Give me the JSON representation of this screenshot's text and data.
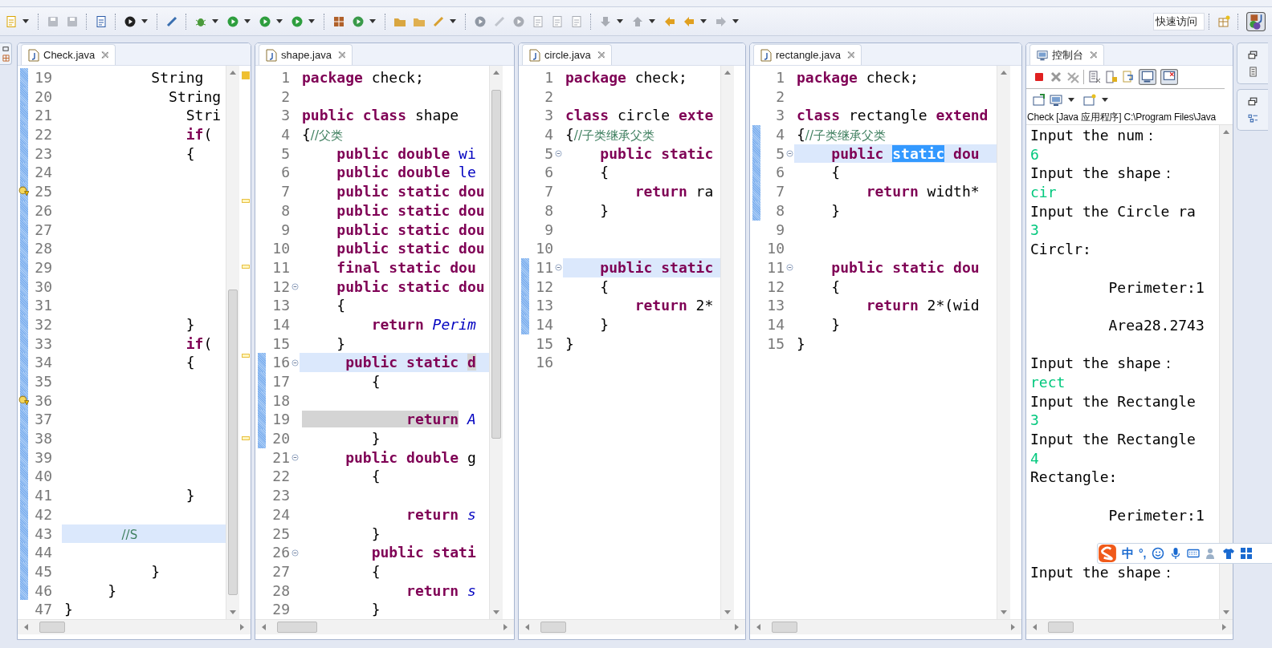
{
  "quick_access": {
    "placeholder": "快速访问"
  },
  "editors": [
    {
      "tab": "Check.java",
      "lines": [
        {
          "num": "19",
          "changed": true,
          "current": false,
          "fold": false,
          "warning": false,
          "tokens": [
            {
              "kind": "pl",
              "text": "          String"
            }
          ]
        },
        {
          "num": "20",
          "changed": true,
          "current": false,
          "fold": false,
          "warning": false,
          "tokens": [
            {
              "kind": "pl",
              "text": "            String"
            }
          ]
        },
        {
          "num": "21",
          "changed": true,
          "current": false,
          "fold": false,
          "warning": false,
          "tokens": [
            {
              "kind": "pl",
              "text": "              Stri"
            }
          ]
        },
        {
          "num": "22",
          "changed": true,
          "current": false,
          "fold": false,
          "warning": false,
          "tokens": [
            {
              "kind": "kw",
              "text": "              if"
            },
            {
              "kind": "pl",
              "text": "("
            }
          ]
        },
        {
          "num": "23",
          "changed": true,
          "current": false,
          "fold": false,
          "warning": false,
          "tokens": [
            {
              "kind": "pl",
              "text": "              {"
            }
          ]
        },
        {
          "num": "24",
          "changed": true,
          "current": false,
          "fold": false,
          "warning": false
        },
        {
          "num": "25",
          "changed": true,
          "current": false,
          "fold": false,
          "warning": true
        },
        {
          "num": "26",
          "changed": true,
          "current": false,
          "fold": false,
          "warning": false
        },
        {
          "num": "27",
          "changed": true,
          "current": false,
          "fold": false,
          "warning": false
        },
        {
          "num": "28",
          "changed": true,
          "current": false,
          "fold": false,
          "warning": false
        },
        {
          "num": "29",
          "changed": true,
          "current": false,
          "fold": false,
          "warning": false
        },
        {
          "num": "30",
          "changed": true,
          "current": false,
          "fold": false,
          "warning": false
        },
        {
          "num": "31",
          "changed": true,
          "current": false,
          "fold": false,
          "warning": false
        },
        {
          "num": "32",
          "changed": true,
          "current": false,
          "fold": false,
          "warning": false,
          "tokens": [
            {
              "kind": "pl",
              "text": "              }"
            }
          ]
        },
        {
          "num": "33",
          "changed": true,
          "current": false,
          "fold": false,
          "warning": false,
          "tokens": [
            {
              "kind": "kw",
              "text": "              if"
            },
            {
              "kind": "pl",
              "text": "("
            }
          ]
        },
        {
          "num": "34",
          "changed": true,
          "current": false,
          "fold": false,
          "warning": false,
          "tokens": [
            {
              "kind": "pl",
              "text": "              {"
            }
          ]
        },
        {
          "num": "35",
          "changed": true,
          "current": false,
          "fold": false,
          "warning": false
        },
        {
          "num": "36",
          "changed": true,
          "current": false,
          "fold": false,
          "warning": true
        },
        {
          "num": "37",
          "changed": true,
          "current": false,
          "fold": false,
          "warning": false
        },
        {
          "num": "38",
          "changed": true,
          "current": false,
          "fold": false,
          "warning": false
        },
        {
          "num": "39",
          "changed": true,
          "current": false,
          "fold": false,
          "warning": false
        },
        {
          "num": "40",
          "changed": true,
          "current": false,
          "fold": false,
          "warning": false
        },
        {
          "num": "41",
          "changed": true,
          "current": false,
          "fold": false,
          "warning": false,
          "tokens": [
            {
              "kind": "pl",
              "text": "              }"
            }
          ]
        },
        {
          "num": "42",
          "changed": true,
          "current": false,
          "fold": false,
          "warning": false
        },
        {
          "num": "43",
          "changed": true,
          "current": true,
          "fold": false,
          "warning": false,
          "tokens": [
            {
              "kind": "cm",
              "text": "               //S"
            }
          ]
        },
        {
          "num": "44",
          "changed": true,
          "current": false,
          "fold": false,
          "warning": false
        },
        {
          "num": "45",
          "changed": true,
          "current": false,
          "fold": false,
          "warning": false,
          "tokens": [
            {
              "kind": "pl",
              "text": "          }"
            }
          ]
        },
        {
          "num": "46",
          "changed": true,
          "current": false,
          "fold": false,
          "warning": false,
          "tokens": [
            {
              "kind": "pl",
              "text": "     }"
            }
          ]
        },
        {
          "num": "47",
          "changed": false,
          "current": false,
          "fold": false,
          "warning": false,
          "tokens": [
            {
              "kind": "pl",
              "text": "}"
            }
          ]
        }
      ]
    },
    {
      "tab": "shape.java",
      "lines": [
        {
          "num": "1",
          "changed": false,
          "current": false,
          "fold": false,
          "warning": false,
          "tokens": [
            {
              "kind": "kw",
              "text": "package"
            },
            {
              "kind": "pl",
              "text": " check;"
            }
          ]
        },
        {
          "num": "2",
          "changed": false,
          "current": false,
          "fold": false,
          "warning": false
        },
        {
          "num": "3",
          "changed": false,
          "current": false,
          "fold": false,
          "warning": false,
          "tokens": [
            {
              "kind": "kw",
              "text": "public class"
            },
            {
              "kind": "pl",
              "text": " shape"
            }
          ]
        },
        {
          "num": "4",
          "changed": false,
          "current": false,
          "fold": false,
          "warning": false,
          "tokens": [
            {
              "kind": "pl",
              "text": "{"
            },
            {
              "kind": "cm",
              "text": "//父类"
            }
          ]
        },
        {
          "num": "5",
          "changed": false,
          "current": false,
          "fold": false,
          "warning": false,
          "tokens": [
            {
              "kind": "kw",
              "text": "    public double"
            },
            {
              "kind": "fld",
              "text": " wi"
            }
          ]
        },
        {
          "num": "6",
          "changed": false,
          "current": false,
          "fold": false,
          "warning": false,
          "tokens": [
            {
              "kind": "kw",
              "text": "    public double"
            },
            {
              "kind": "fld",
              "text": " le"
            }
          ]
        },
        {
          "num": "7",
          "changed": false,
          "current": false,
          "fold": false,
          "warning": false,
          "tokens": [
            {
              "kind": "kw",
              "text": "    public static dou"
            }
          ]
        },
        {
          "num": "8",
          "changed": false,
          "current": false,
          "fold": false,
          "warning": false,
          "tokens": [
            {
              "kind": "kw",
              "text": "    public static dou"
            }
          ]
        },
        {
          "num": "9",
          "changed": false,
          "current": false,
          "fold": false,
          "warning": false,
          "tokens": [
            {
              "kind": "kw",
              "text": "    public static dou"
            }
          ]
        },
        {
          "num": "10",
          "changed": false,
          "current": false,
          "fold": false,
          "warning": false,
          "tokens": [
            {
              "kind": "kw",
              "text": "    public static dou"
            }
          ]
        },
        {
          "num": "11",
          "changed": false,
          "current": false,
          "fold": false,
          "warning": false,
          "tokens": [
            {
              "kind": "kw",
              "text": "    final static dou"
            }
          ]
        },
        {
          "num": "12",
          "changed": false,
          "current": false,
          "fold": true,
          "warning": false,
          "tokens": [
            {
              "kind": "kw",
              "text": "    public static dou"
            }
          ]
        },
        {
          "num": "13",
          "changed": false,
          "current": false,
          "fold": false,
          "warning": false,
          "tokens": [
            {
              "kind": "pl",
              "text": "    {"
            }
          ]
        },
        {
          "num": "14",
          "changed": false,
          "current": false,
          "fold": false,
          "warning": false,
          "tokens": [
            {
              "kind": "kw",
              "text": "        return"
            },
            {
              "kind": "fldi",
              "text": " Perim"
            }
          ]
        },
        {
          "num": "15",
          "changed": false,
          "current": false,
          "fold": false,
          "warning": false,
          "tokens": [
            {
              "kind": "pl",
              "text": "    }"
            }
          ]
        },
        {
          "num": "16",
          "changed": true,
          "current": true,
          "fold": true,
          "warning": false,
          "tokens": [
            {
              "kind": "kw",
              "text": "     public static "
            },
            {
              "kind": "occ",
              "text": "d"
            }
          ]
        },
        {
          "num": "17",
          "changed": true,
          "current": false,
          "fold": false,
          "warning": false,
          "tokens": [
            {
              "kind": "pl",
              "text": "        {"
            }
          ]
        },
        {
          "num": "18",
          "changed": true,
          "current": false,
          "fold": false,
          "warning": false
        },
        {
          "num": "19",
          "changed": true,
          "current": false,
          "fold": false,
          "warning": false,
          "tokens": [
            {
              "kind": "occ",
              "text": "            return"
            },
            {
              "kind": "fldi",
              "text": " A"
            }
          ]
        },
        {
          "num": "20",
          "changed": true,
          "current": false,
          "fold": false,
          "warning": false,
          "tokens": [
            {
              "kind": "pl",
              "text": "        }"
            }
          ]
        },
        {
          "num": "21",
          "changed": false,
          "current": false,
          "fold": true,
          "warning": false,
          "tokens": [
            {
              "kind": "kw",
              "text": "     public double"
            },
            {
              "kind": "pl",
              "text": " g"
            }
          ]
        },
        {
          "num": "22",
          "changed": false,
          "current": false,
          "fold": false,
          "warning": false,
          "tokens": [
            {
              "kind": "pl",
              "text": "        {"
            }
          ]
        },
        {
          "num": "23",
          "changed": false,
          "current": false,
          "fold": false,
          "warning": false
        },
        {
          "num": "24",
          "changed": false,
          "current": false,
          "fold": false,
          "warning": false,
          "tokens": [
            {
              "kind": "kw",
              "text": "            return"
            },
            {
              "kind": "fldi",
              "text": " s"
            }
          ]
        },
        {
          "num": "25",
          "changed": false,
          "current": false,
          "fold": false,
          "warning": false,
          "tokens": [
            {
              "kind": "pl",
              "text": "        }"
            }
          ]
        },
        {
          "num": "26",
          "changed": false,
          "current": false,
          "fold": true,
          "warning": false,
          "tokens": [
            {
              "kind": "kw",
              "text": "        public stati"
            }
          ]
        },
        {
          "num": "27",
          "changed": false,
          "current": false,
          "fold": false,
          "warning": false,
          "tokens": [
            {
              "kind": "pl",
              "text": "        {"
            }
          ]
        },
        {
          "num": "28",
          "changed": false,
          "current": false,
          "fold": false,
          "warning": false,
          "tokens": [
            {
              "kind": "kw",
              "text": "            return"
            },
            {
              "kind": "fldi",
              "text": " s"
            }
          ]
        },
        {
          "num": "29",
          "changed": false,
          "current": false,
          "fold": false,
          "warning": false,
          "tokens": [
            {
              "kind": "pl",
              "text": "        }"
            }
          ]
        }
      ]
    },
    {
      "tab": "circle.java",
      "lines": [
        {
          "num": "1",
          "changed": false,
          "current": false,
          "fold": false,
          "warning": false,
          "tokens": [
            {
              "kind": "kw",
              "text": "package"
            },
            {
              "kind": "pl",
              "text": " check;"
            }
          ]
        },
        {
          "num": "2",
          "changed": false,
          "current": false,
          "fold": false,
          "warning": false
        },
        {
          "num": "3",
          "changed": false,
          "current": false,
          "fold": false,
          "warning": false,
          "tokens": [
            {
              "kind": "kw",
              "text": "class"
            },
            {
              "kind": "pl",
              "text": " circle"
            },
            {
              "kind": "kw",
              "text": " exte"
            }
          ]
        },
        {
          "num": "4",
          "changed": false,
          "current": false,
          "fold": false,
          "warning": false,
          "tokens": [
            {
              "kind": "pl",
              "text": "{"
            },
            {
              "kind": "cm",
              "text": "//子类继承父类"
            }
          ]
        },
        {
          "num": "5",
          "changed": false,
          "current": false,
          "fold": true,
          "warning": false,
          "tokens": [
            {
              "kind": "kw",
              "text": "    public static"
            }
          ]
        },
        {
          "num": "6",
          "changed": false,
          "current": false,
          "fold": false,
          "warning": false,
          "tokens": [
            {
              "kind": "pl",
              "text": "    {"
            }
          ]
        },
        {
          "num": "7",
          "changed": false,
          "current": false,
          "fold": false,
          "warning": false,
          "tokens": [
            {
              "kind": "kw",
              "text": "        return"
            },
            {
              "kind": "pl",
              "text": " ra"
            }
          ]
        },
        {
          "num": "8",
          "changed": false,
          "current": false,
          "fold": false,
          "warning": false,
          "tokens": [
            {
              "kind": "pl",
              "text": "    }"
            }
          ]
        },
        {
          "num": "9",
          "changed": false,
          "current": false,
          "fold": false,
          "warning": false
        },
        {
          "num": "10",
          "changed": false,
          "current": false,
          "fold": false,
          "warning": false
        },
        {
          "num": "11",
          "changed": true,
          "current": true,
          "fold": true,
          "warning": false,
          "tokens": [
            {
              "kind": "kw",
              "text": "    public static"
            }
          ]
        },
        {
          "num": "12",
          "changed": true,
          "current": false,
          "fold": false,
          "warning": false,
          "tokens": [
            {
              "kind": "pl",
              "text": "    {"
            }
          ]
        },
        {
          "num": "13",
          "changed": true,
          "current": false,
          "fold": false,
          "warning": false,
          "tokens": [
            {
              "kind": "kw",
              "text": "        return"
            },
            {
              "kind": "pl",
              "text": " 2*"
            }
          ]
        },
        {
          "num": "14",
          "changed": true,
          "current": false,
          "fold": false,
          "warning": false,
          "tokens": [
            {
              "kind": "pl",
              "text": "    }"
            }
          ]
        },
        {
          "num": "15",
          "changed": false,
          "current": false,
          "fold": false,
          "warning": false,
          "tokens": [
            {
              "kind": "pl",
              "text": "}"
            }
          ]
        },
        {
          "num": "16",
          "changed": false,
          "current": false,
          "fold": false,
          "warning": false
        }
      ]
    },
    {
      "tab": "rectangle.java",
      "lines": [
        {
          "num": "1",
          "changed": false,
          "current": false,
          "fold": false,
          "warning": false,
          "tokens": [
            {
              "kind": "kw",
              "text": "package"
            },
            {
              "kind": "pl",
              "text": " check;"
            }
          ]
        },
        {
          "num": "2",
          "changed": false,
          "current": false,
          "fold": false,
          "warning": false
        },
        {
          "num": "3",
          "changed": false,
          "current": false,
          "fold": false,
          "warning": false,
          "tokens": [
            {
              "kind": "kw",
              "text": "class"
            },
            {
              "kind": "pl",
              "text": " rectangle"
            },
            {
              "kind": "kw",
              "text": " extend"
            }
          ]
        },
        {
          "num": "4",
          "changed": true,
          "current": false,
          "fold": false,
          "warning": false,
          "tokens": [
            {
              "kind": "pl",
              "text": "{"
            },
            {
              "kind": "cm",
              "text": "//子类继承父类"
            }
          ]
        },
        {
          "num": "5",
          "changed": true,
          "current": true,
          "fold": true,
          "warning": false,
          "tokens": [
            {
              "kind": "kw",
              "text": "    public "
            },
            {
              "kind": "sel",
              "text": "static"
            },
            {
              "kind": "kw",
              "text": " dou"
            }
          ]
        },
        {
          "num": "6",
          "changed": true,
          "current": false,
          "fold": false,
          "warning": false,
          "tokens": [
            {
              "kind": "pl",
              "text": "    {"
            }
          ]
        },
        {
          "num": "7",
          "changed": true,
          "current": false,
          "fold": false,
          "warning": false,
          "tokens": [
            {
              "kind": "kw",
              "text": "        return"
            },
            {
              "kind": "pl",
              "text": " width*"
            }
          ]
        },
        {
          "num": "8",
          "changed": true,
          "current": false,
          "fold": false,
          "warning": false,
          "tokens": [
            {
              "kind": "pl",
              "text": "    }"
            }
          ]
        },
        {
          "num": "9",
          "changed": false,
          "current": false,
          "fold": false,
          "warning": false
        },
        {
          "num": "10",
          "changed": false,
          "current": false,
          "fold": false,
          "warning": false
        },
        {
          "num": "11",
          "changed": false,
          "current": false,
          "fold": true,
          "warning": false,
          "tokens": [
            {
              "kind": "kw",
              "text": "    public static dou"
            }
          ]
        },
        {
          "num": "12",
          "changed": false,
          "current": false,
          "fold": false,
          "warning": false,
          "tokens": [
            {
              "kind": "pl",
              "text": "    {"
            }
          ]
        },
        {
          "num": "13",
          "changed": false,
          "current": false,
          "fold": false,
          "warning": false,
          "tokens": [
            {
              "kind": "kw",
              "text": "        return"
            },
            {
              "kind": "pl",
              "text": " 2*(wid"
            }
          ]
        },
        {
          "num": "14",
          "changed": false,
          "current": false,
          "fold": false,
          "warning": false,
          "tokens": [
            {
              "kind": "pl",
              "text": "    }"
            }
          ]
        },
        {
          "num": "15",
          "changed": false,
          "current": false,
          "fold": false,
          "warning": false,
          "tokens": [
            {
              "kind": "pl",
              "text": "}"
            }
          ]
        }
      ]
    }
  ],
  "console": {
    "tab": "控制台",
    "process": "Check [Java 应用程序] C:\\Program Files\\Java",
    "lines": [
      {
        "kind": "out",
        "text": "Input the num："
      },
      {
        "kind": "in",
        "text": "6"
      },
      {
        "kind": "out",
        "text": "Input the shape："
      },
      {
        "kind": "in",
        "text": "cir"
      },
      {
        "kind": "out",
        "text": "Input the Circle ra"
      },
      {
        "kind": "in",
        "text": "3"
      },
      {
        "kind": "out",
        "text": "Circlr:"
      },
      {
        "kind": "blank"
      },
      {
        "kind": "out",
        "text": "         Perimeter:1"
      },
      {
        "kind": "blank"
      },
      {
        "kind": "out",
        "text": "         Area28.2743"
      },
      {
        "kind": "blank"
      },
      {
        "kind": "out",
        "text": "Input the shape："
      },
      {
        "kind": "in",
        "text": "rect"
      },
      {
        "kind": "out",
        "text": "Input the Rectangle"
      },
      {
        "kind": "in",
        "text": "3"
      },
      {
        "kind": "out",
        "text": "Input the Rectangle"
      },
      {
        "kind": "in",
        "text": "4"
      },
      {
        "kind": "out",
        "text": "Rectangle:"
      },
      {
        "kind": "blank"
      },
      {
        "kind": "out",
        "text": "         Perimeter:1"
      },
      {
        "kind": "blank"
      },
      {
        "kind": "blank"
      },
      {
        "kind": "out",
        "text": "Input the shape："
      }
    ]
  },
  "ime": {
    "mode": "中",
    "punctuation": "°,"
  }
}
